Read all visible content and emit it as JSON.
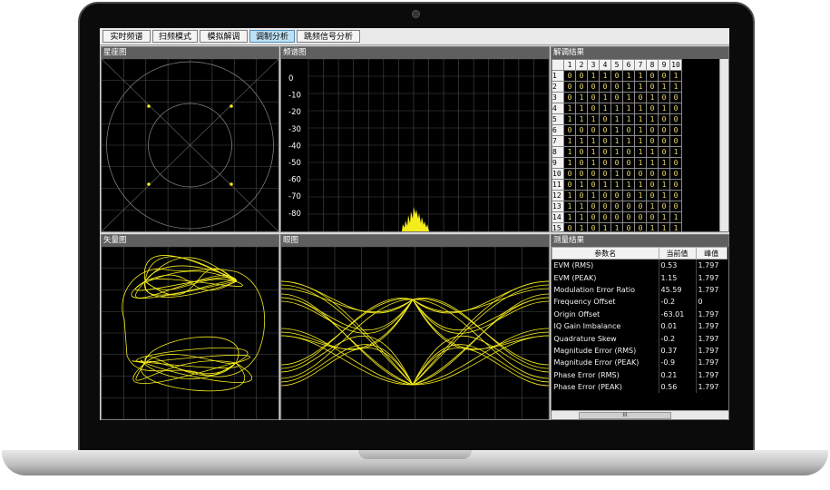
{
  "tabs": [
    {
      "label": "实时频谱",
      "active": false
    },
    {
      "label": "扫频模式",
      "active": false
    },
    {
      "label": "模拟解调",
      "active": false
    },
    {
      "label": "调制分析",
      "active": true
    },
    {
      "label": "跳频信号分析",
      "active": false
    }
  ],
  "panels": {
    "constellation": {
      "title": "星座图"
    },
    "spectrum": {
      "title": "频谱图",
      "y_ticks": [
        "0",
        "-10",
        "-20",
        "-30",
        "-40",
        "-50",
        "-60",
        "-70",
        "-80"
      ]
    },
    "vector": {
      "title": "矢量图"
    },
    "eye": {
      "title": "眼图"
    },
    "demod_result": {
      "title": "解调结果",
      "columns": [
        "1",
        "2",
        "3",
        "4",
        "5",
        "6",
        "7",
        "8",
        "9",
        "10"
      ],
      "rows": [
        {
          "label": "1",
          "bits": [
            "0",
            "0",
            "1",
            "1",
            "0",
            "1",
            "1",
            "0",
            "0",
            "1"
          ]
        },
        {
          "label": "2",
          "bits": [
            "0",
            "0",
            "0",
            "0",
            "0",
            "1",
            "1",
            "0",
            "1",
            "1"
          ]
        },
        {
          "label": "3",
          "bits": [
            "0",
            "1",
            "0",
            "1",
            "0",
            "1",
            "0",
            "1",
            "0",
            "0"
          ]
        },
        {
          "label": "4",
          "bits": [
            "1",
            "1",
            "0",
            "1",
            "1",
            "1",
            "1",
            "0",
            "1",
            "0"
          ]
        },
        {
          "label": "5",
          "bits": [
            "1",
            "1",
            "1",
            "0",
            "1",
            "1",
            "1",
            "1",
            "0",
            "0"
          ]
        },
        {
          "label": "6",
          "bits": [
            "0",
            "0",
            "0",
            "0",
            "1",
            "0",
            "1",
            "0",
            "0",
            "0"
          ]
        },
        {
          "label": "7",
          "bits": [
            "1",
            "1",
            "1",
            "0",
            "1",
            "1",
            "1",
            "0",
            "0",
            "0"
          ]
        },
        {
          "label": "8",
          "bits": [
            "1",
            "0",
            "1",
            "0",
            "1",
            "0",
            "1",
            "1",
            "0",
            "1"
          ]
        },
        {
          "label": "9",
          "bits": [
            "1",
            "0",
            "1",
            "0",
            "0",
            "0",
            "1",
            "1",
            "1",
            "0"
          ]
        },
        {
          "label": "10",
          "bits": [
            "0",
            "0",
            "0",
            "0",
            "1",
            "0",
            "0",
            "0",
            "0",
            "0"
          ]
        },
        {
          "label": "11",
          "bits": [
            "0",
            "1",
            "0",
            "1",
            "1",
            "1",
            "1",
            "0",
            "1",
            "0"
          ]
        },
        {
          "label": "12",
          "bits": [
            "1",
            "0",
            "1",
            "0",
            "0",
            "0",
            "1",
            "0",
            "1",
            "0"
          ]
        },
        {
          "label": "13",
          "bits": [
            "1",
            "1",
            "0",
            "0",
            "0",
            "0",
            "0",
            "1",
            "0",
            "0"
          ]
        },
        {
          "label": "14",
          "bits": [
            "1",
            "1",
            "0",
            "0",
            "0",
            "0",
            "0",
            "0",
            "1",
            "1"
          ]
        },
        {
          "label": "15",
          "bits": [
            "0",
            "1",
            "0",
            "1",
            "1",
            "0",
            "0",
            "1",
            "1",
            "1"
          ]
        }
      ]
    },
    "measurement": {
      "title": "测量结果",
      "headers": {
        "name": "参数名",
        "current": "当前值",
        "peak": "峰值"
      },
      "rows": [
        {
          "name": "EVM (RMS)",
          "current": "0.53",
          "peak": "1.797"
        },
        {
          "name": "EVM (PEAK)",
          "current": "1.15",
          "peak": "1.797"
        },
        {
          "name": "Modulation Error Ratio",
          "current": "45.59",
          "peak": "1.797"
        },
        {
          "name": "Frequency Offset",
          "current": "-0.2",
          "peak": "0"
        },
        {
          "name": "Origin Offset",
          "current": "-63.01",
          "peak": "1.797"
        },
        {
          "name": "IQ Gain Imbalance",
          "current": "0.01",
          "peak": "1.797"
        },
        {
          "name": "Quadrature Skew",
          "current": "-0.2",
          "peak": "1.797"
        },
        {
          "name": "Magnitude Error (RMS)",
          "current": "0.37",
          "peak": "1.797"
        },
        {
          "name": "Magnitude Error (PEAK)",
          "current": "-0.9",
          "peak": "1.797"
        },
        {
          "name": "Phase Error (RMS)",
          "current": "0.21",
          "peak": "1.797"
        },
        {
          "name": "Phase Error (PEAK)",
          "current": "0.56",
          "peak": "1.797"
        }
      ],
      "scroll_glyph": "III"
    }
  },
  "colors": {
    "trace": "#f5ec1c",
    "grid": "#4a4a4a",
    "bit_text": "#e9d86b"
  }
}
